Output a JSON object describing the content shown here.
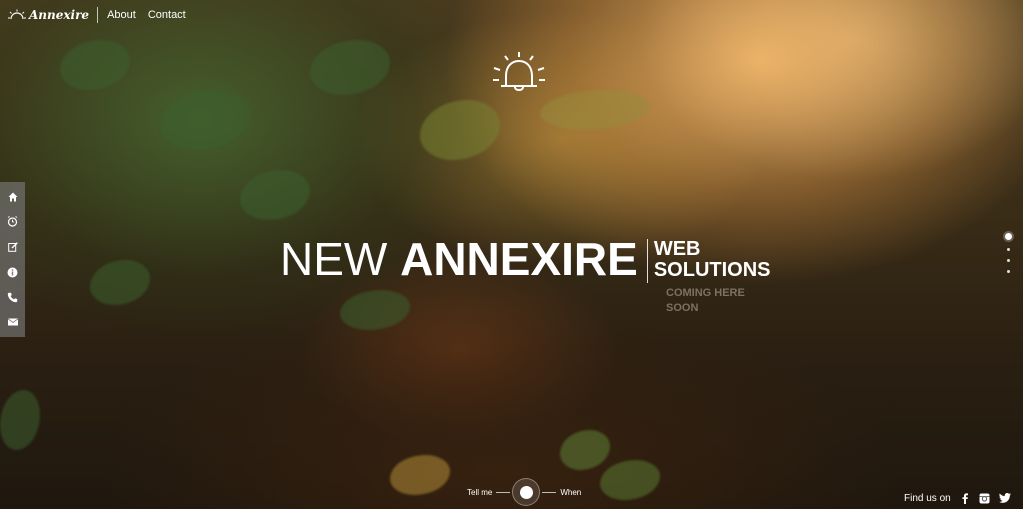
{
  "brand": {
    "name": "Annexire"
  },
  "nav": {
    "items": [
      {
        "label": "About"
      },
      {
        "label": "Contact"
      }
    ]
  },
  "sidebar": {
    "items": [
      {
        "icon": "home-icon"
      },
      {
        "icon": "alarm-clock-icon"
      },
      {
        "icon": "edit-icon"
      },
      {
        "icon": "info-icon"
      },
      {
        "icon": "phone-icon"
      },
      {
        "icon": "mail-icon"
      }
    ]
  },
  "hero": {
    "icon": "bell-icon",
    "title_light": "NEW",
    "title_bold": "ANNEXIRE",
    "side_line1": "WEB",
    "side_line2": "SOLUTIONS",
    "coming_line1": "COMING HERE",
    "coming_line2": "SOON"
  },
  "pager": {
    "count": 4,
    "active_index": 0
  },
  "notify": {
    "left_label": "Tell me",
    "right_label": "When"
  },
  "footer": {
    "find_us_label": "Find us on",
    "social": [
      "facebook-icon",
      "instagram-icon",
      "twitter-icon"
    ]
  }
}
